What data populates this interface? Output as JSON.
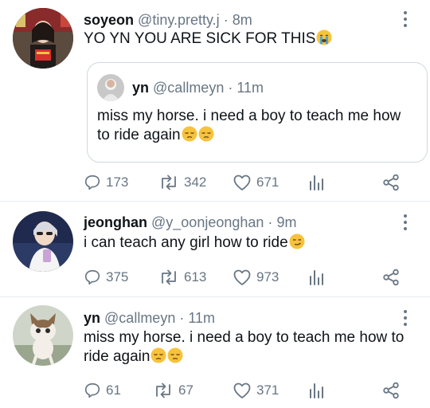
{
  "tweets": [
    {
      "name": "soyeon",
      "handle": "@tiny.pretty.j",
      "separator": "·",
      "time": "8m",
      "text": "YO YN YOU ARE SICK FOR THIS",
      "emoji": [
        "loudly-crying-face"
      ],
      "quote": {
        "name": "yn",
        "handle": "@callmeyn",
        "separator": "·",
        "time": "11m",
        "text": "miss my horse. i need a boy to teach me how to ride again",
        "emoji": [
          "pensive-face",
          "pensive-face"
        ]
      },
      "replies": "173",
      "retweets": "342",
      "likes": "671"
    },
    {
      "name": "jeonghan",
      "handle": "@y_oonjeonghan",
      "separator": "·",
      "time": "9m",
      "text": "i can teach any girl how to ride",
      "emoji": [
        "smirking-face"
      ],
      "replies": "375",
      "retweets": "613",
      "likes": "973"
    },
    {
      "name": "yn",
      "handle": "@callmeyn",
      "separator": "·",
      "time": "11m",
      "text": "miss my horse. i need a boy to teach me how to ride again",
      "emoji": [
        "pensive-face",
        "pensive-face"
      ],
      "replies": "61",
      "retweets": "67",
      "likes": "371"
    }
  ],
  "colors": {
    "text": "#0f1419",
    "secondary": "#687684",
    "border": "#cfd9de",
    "divider": "#e6ecf0",
    "emoji_yellow": "#f7c23c"
  }
}
